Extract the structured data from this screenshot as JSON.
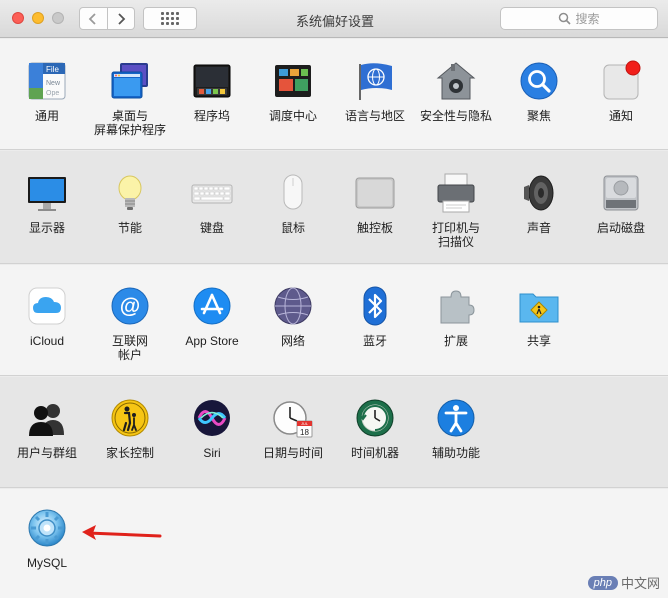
{
  "window": {
    "title": "系统偏好设置"
  },
  "search": {
    "placeholder": "搜索"
  },
  "rows": [
    [
      {
        "name": "general",
        "label": "通用"
      },
      {
        "name": "desktop-screensaver",
        "label": "桌面与\n屏幕保护程序"
      },
      {
        "name": "dock",
        "label": "程序坞"
      },
      {
        "name": "mission-control",
        "label": "调度中心"
      },
      {
        "name": "language-region",
        "label": "语言与地区"
      },
      {
        "name": "security-privacy",
        "label": "安全性与隐私"
      },
      {
        "name": "spotlight",
        "label": "聚焦"
      },
      {
        "name": "notifications",
        "label": "通知"
      }
    ],
    [
      {
        "name": "displays",
        "label": "显示器"
      },
      {
        "name": "energy-saver",
        "label": "节能"
      },
      {
        "name": "keyboard",
        "label": "键盘"
      },
      {
        "name": "mouse",
        "label": "鼠标"
      },
      {
        "name": "trackpad",
        "label": "触控板"
      },
      {
        "name": "printers-scanners",
        "label": "打印机与\n扫描仪"
      },
      {
        "name": "sound",
        "label": "声音"
      },
      {
        "name": "startup-disk",
        "label": "启动磁盘"
      }
    ],
    [
      {
        "name": "icloud",
        "label": "iCloud"
      },
      {
        "name": "internet-accounts",
        "label": "互联网\n帐户"
      },
      {
        "name": "app-store",
        "label": "App Store"
      },
      {
        "name": "network",
        "label": "网络"
      },
      {
        "name": "bluetooth",
        "label": "蓝牙"
      },
      {
        "name": "extensions",
        "label": "扩展"
      },
      {
        "name": "sharing",
        "label": "共享"
      }
    ],
    [
      {
        "name": "users-groups",
        "label": "用户与群组"
      },
      {
        "name": "parental-controls",
        "label": "家长控制"
      },
      {
        "name": "siri",
        "label": "Siri"
      },
      {
        "name": "date-time",
        "label": "日期与时间"
      },
      {
        "name": "time-machine",
        "label": "时间机器"
      },
      {
        "name": "accessibility",
        "label": "辅助功能"
      }
    ],
    [
      {
        "name": "mysql",
        "label": "MySQL"
      }
    ]
  ],
  "icon_texts": {
    "general_file": "File",
    "general_new": "New",
    "general_ope": "Ope",
    "calendar_month": "JUL",
    "calendar_day": "18"
  },
  "watermark": {
    "badge": "php",
    "text": "中文网"
  },
  "colors": {
    "annotation_arrow": "#e0221b",
    "accent": "#1f7be0"
  }
}
